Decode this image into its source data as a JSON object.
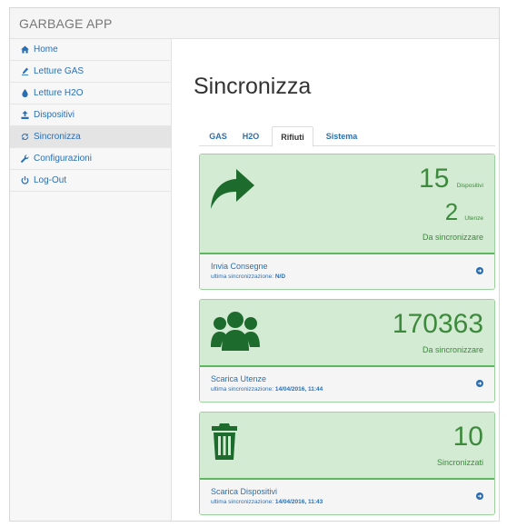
{
  "app": {
    "brand": "GARBAGE APP"
  },
  "sidebar": {
    "items": [
      {
        "label": "Home",
        "icon": "home-icon"
      },
      {
        "label": "Letture GAS",
        "icon": "gas-icon"
      },
      {
        "label": "Letture H2O",
        "icon": "water-drop-icon"
      },
      {
        "label": "Dispositivi",
        "icon": "upload-icon"
      },
      {
        "label": "Sincronizza",
        "icon": "refresh-icon",
        "active": true
      },
      {
        "label": "Configurazioni",
        "icon": "wrench-icon"
      },
      {
        "label": "Log-Out",
        "icon": "power-icon"
      }
    ]
  },
  "main": {
    "title": "Sincronizza",
    "tabs": [
      {
        "label": "GAS"
      },
      {
        "label": "H2O"
      },
      {
        "label": "Rifiuti",
        "active": true
      },
      {
        "label": "Sistema"
      }
    ],
    "panels": [
      {
        "icon": "share-arrow-icon",
        "primary_value": "15",
        "primary_unit": "Dispositivi",
        "secondary_value": "2",
        "secondary_unit": "Utenze",
        "caption": "Da sincronizzare",
        "link": "Invia Consegne",
        "sync_label": "ultima sincronizzazione:",
        "sync_value": "N/D"
      },
      {
        "icon": "users-icon",
        "primary_value": "170363",
        "caption": "Da sincronizzare",
        "link": "Scarica Utenze",
        "sync_label": "ultima sincronizzazione:",
        "sync_value": "14/04/2016, 11:44"
      },
      {
        "icon": "trash-icon",
        "primary_value": "10",
        "caption": "Sincronizzati",
        "link": "Scarica Dispositivi",
        "sync_label": "ultima sincronizzazione:",
        "sync_value": "14/04/2016, 11:43"
      }
    ]
  },
  "colors": {
    "link": "#2a6fb4",
    "panel_bg": "#d3ead3",
    "panel_border": "#5cb85c",
    "panel_number": "#3d8a3d",
    "panel_icon": "#1e6b2e"
  }
}
